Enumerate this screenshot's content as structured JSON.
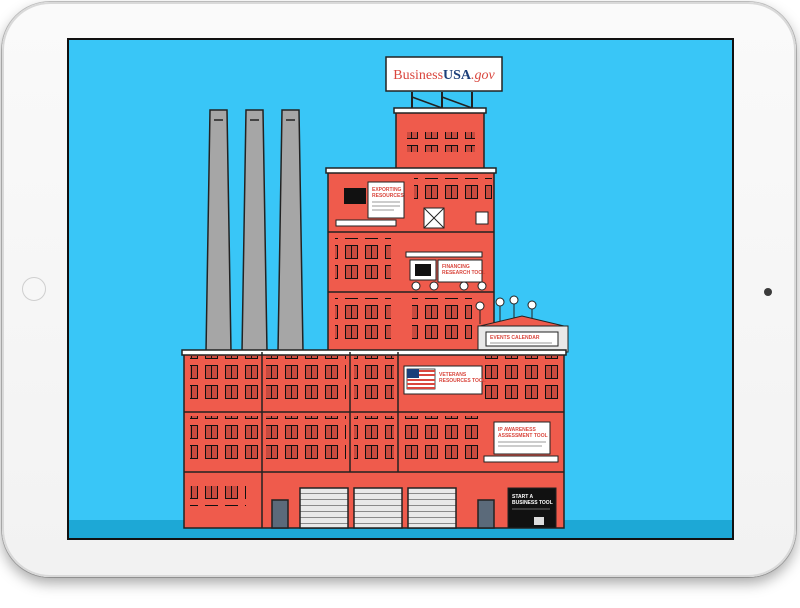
{
  "device": {
    "type": "tablet-landscape"
  },
  "scene": {
    "sky_color": "#39c6f7",
    "ground_color": "#1da8d6",
    "building_color": "#ef5b4c",
    "chimney_color": "#a6a6a6"
  },
  "logo": {
    "text_business": "Business",
    "text_usa": "USA",
    "text_gov": ".gov"
  },
  "cards": {
    "exporting": {
      "title_line1": "EXPORTING",
      "title_line2": "RESOURCES"
    },
    "financing": {
      "title_line1": "FINANCING",
      "title_line2": "RESEARCH TOOL"
    },
    "events": {
      "title": "EVENTS CALENDAR"
    },
    "veterans": {
      "title_line1": "VETERANS",
      "title_line2": "RESOURCES TOOL"
    },
    "ip": {
      "title_line1": "IP AWARENESS",
      "title_line2": "ASSESSMENT TOOL"
    },
    "start": {
      "title_line1": "START A",
      "title_line2": "BUSINESS TOOL"
    }
  }
}
